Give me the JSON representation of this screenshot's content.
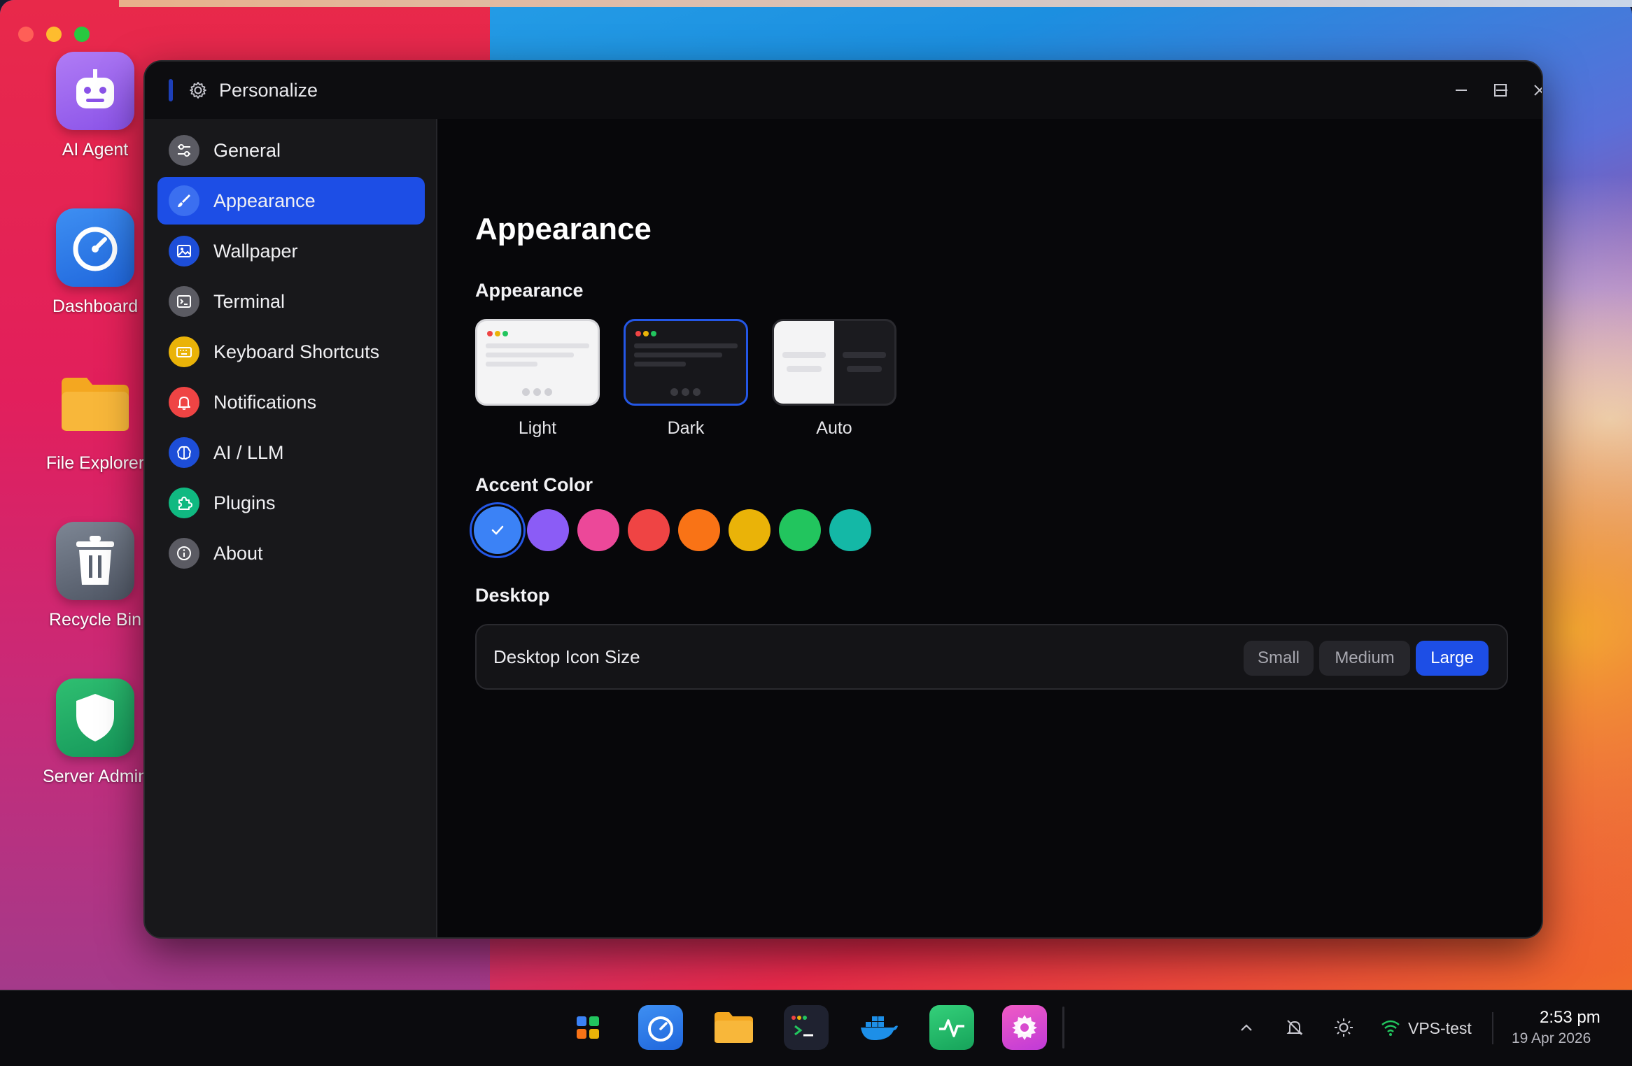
{
  "window": {
    "title": "Personalize",
    "controls": [
      "minimize",
      "maximize",
      "close"
    ]
  },
  "desktop_icons": [
    {
      "label": "AI Agent",
      "icon": "robot-icon"
    },
    {
      "label": "Dashboard",
      "icon": "speedometer-icon"
    },
    {
      "label": "File Explorer",
      "icon": "folder-icon"
    },
    {
      "label": "Recycle Bin",
      "icon": "trash-icon"
    },
    {
      "label": "Server Admin",
      "icon": "shield-icon"
    }
  ],
  "sidebar": {
    "items": [
      {
        "label": "General",
        "icon": "sliders-icon",
        "active": false
      },
      {
        "label": "Appearance",
        "icon": "brush-icon",
        "active": true
      },
      {
        "label": "Wallpaper",
        "icon": "image-icon",
        "active": false
      },
      {
        "label": "Terminal",
        "icon": "terminal-icon",
        "active": false
      },
      {
        "label": "Keyboard Shortcuts",
        "icon": "keyboard-icon",
        "active": false
      },
      {
        "label": "Notifications",
        "icon": "bell-icon",
        "active": false
      },
      {
        "label": "AI / LLM",
        "icon": "brain-icon",
        "active": false
      },
      {
        "label": "Plugins",
        "icon": "puzzle-icon",
        "active": false
      },
      {
        "label": "About",
        "icon": "info-icon",
        "active": false
      }
    ]
  },
  "main": {
    "page_title": "Appearance",
    "appearance_section": {
      "heading": "Appearance",
      "options": [
        {
          "label": "Light",
          "selected": false
        },
        {
          "label": "Dark",
          "selected": true
        },
        {
          "label": "Auto",
          "selected": false
        }
      ]
    },
    "accent_section": {
      "heading": "Accent Color",
      "colors": [
        "#3b82f6",
        "#8b5cf6",
        "#ec4899",
        "#ef4444",
        "#f97316",
        "#eab308",
        "#22c55e",
        "#14b8a6"
      ],
      "selected_index": 0
    },
    "desktop_section": {
      "heading": "Desktop",
      "icon_size_label": "Desktop Icon Size",
      "sizes": [
        "Small",
        "Medium",
        "Large"
      ],
      "selected_size": "Large"
    }
  },
  "taskbar": {
    "apps": [
      "start-icon",
      "dashboard-icon",
      "folder-icon",
      "terminal-icon",
      "docker-icon",
      "activity-icon",
      "settings-icon"
    ],
    "network_name": "VPS-test",
    "time": "2:53 pm",
    "date": "19 Apr 2026"
  }
}
